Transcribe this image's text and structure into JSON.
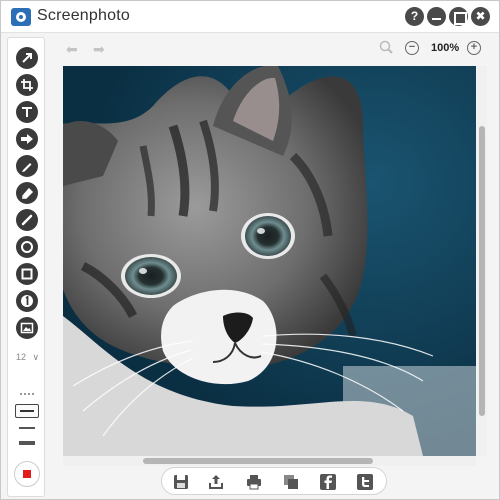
{
  "window": {
    "title": "Screenphoto",
    "controls": {
      "help_label": "?",
      "minimize_label": "",
      "maximize_label": "",
      "close_label": "✖"
    }
  },
  "toolbar": {
    "tools": [
      "arrow-tool",
      "crop-tool",
      "text-tool",
      "shape-arrow-tool",
      "pen-tool",
      "highlighter-tool",
      "line-tool",
      "ellipse-tool",
      "rectangle-tool",
      "number-tool",
      "image-tool"
    ],
    "font_size_label": "12",
    "font_size_arrow": "∨",
    "active_color": "#e01c1c"
  },
  "navigation": {
    "undo_glyph": "⬅",
    "redo_glyph": "➡"
  },
  "zoom": {
    "level": "100%",
    "zoom_out_label": "−",
    "zoom_in_label": "+"
  },
  "image": {
    "subject": "tabby kitten",
    "background_color": "#0d3a52"
  },
  "actions": [
    "save-icon",
    "upload-icon",
    "print-icon",
    "copy-icon",
    "facebook-icon",
    "twitter-icon"
  ],
  "colors": {
    "toolbar_icon": "#3a3a3a",
    "accent_blue": "#2b6fb6",
    "facebook": "#3b5998",
    "twitter": "#55acee"
  }
}
